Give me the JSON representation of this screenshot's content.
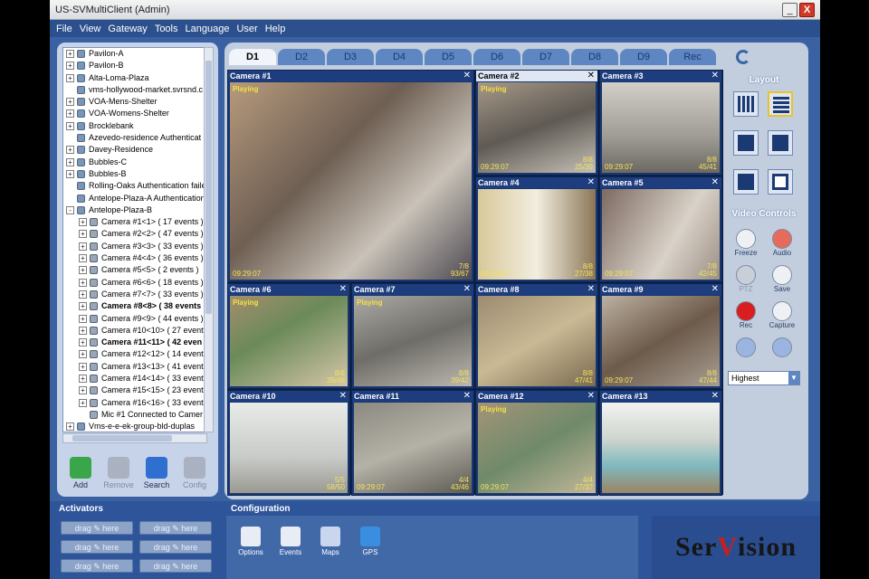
{
  "window": {
    "title": "US-SVMultiClient (Admin)",
    "minimize_glyph": "_",
    "close_glyph": "X"
  },
  "menu": [
    "File",
    "View",
    "Gateway",
    "Tools",
    "Language",
    "User",
    "Help"
  ],
  "tree": [
    {
      "label": "Pavilon-A",
      "lvl": 0,
      "exp": "+",
      "icon": "site"
    },
    {
      "label": "Pavilon-B",
      "lvl": 0,
      "exp": "+",
      "icon": "site"
    },
    {
      "label": "Alta-Loma-Plaza",
      "lvl": 0,
      "exp": "+",
      "icon": "site"
    },
    {
      "label": "vms-hollywood-market.svrsnd.c",
      "lvl": 0,
      "exp": "",
      "icon": "site"
    },
    {
      "label": "VOA-Mens-Shelter",
      "lvl": 0,
      "exp": "+",
      "icon": "site"
    },
    {
      "label": "VOA-Womens-Shelter",
      "lvl": 0,
      "exp": "+",
      "icon": "site"
    },
    {
      "label": "Brocklebank",
      "lvl": 0,
      "exp": "+",
      "icon": "site"
    },
    {
      "label": "Azevedo-residence Authenticat",
      "lvl": 0,
      "exp": "",
      "icon": "site"
    },
    {
      "label": "Davey-Residence",
      "lvl": 0,
      "exp": "+",
      "icon": "site"
    },
    {
      "label": "Bubbles-C",
      "lvl": 0,
      "exp": "+",
      "icon": "site"
    },
    {
      "label": "Bubbles-B",
      "lvl": 0,
      "exp": "+",
      "icon": "site"
    },
    {
      "label": "Rolling-Oaks Authentication faile",
      "lvl": 0,
      "exp": "",
      "icon": "site"
    },
    {
      "label": "Antelope-Plaza-A Authentication",
      "lvl": 0,
      "exp": "",
      "icon": "site"
    },
    {
      "label": "Antelope-Plaza-B",
      "lvl": 0,
      "exp": "-",
      "icon": "site"
    },
    {
      "label": "Camera #1<1> ( 17 events )",
      "lvl": 1,
      "exp": "+",
      "icon": "cam"
    },
    {
      "label": "Camera #2<2> ( 47 events )",
      "lvl": 1,
      "exp": "+",
      "icon": "cam"
    },
    {
      "label": "Camera #3<3> ( 33 events )",
      "lvl": 1,
      "exp": "+",
      "icon": "cam"
    },
    {
      "label": "Camera #4<4> ( 36 events )",
      "lvl": 1,
      "exp": "+",
      "icon": "cam"
    },
    {
      "label": "Camera #5<5> ( 2 events )",
      "lvl": 1,
      "exp": "+",
      "icon": "cam"
    },
    {
      "label": "Camera #6<6> ( 18 events )",
      "lvl": 1,
      "exp": "+",
      "icon": "cam"
    },
    {
      "label": "Camera #7<7> ( 33 events )",
      "lvl": 1,
      "exp": "+",
      "icon": "cam"
    },
    {
      "label": "Camera #8<8> ( 38 events",
      "lvl": 1,
      "exp": "+",
      "icon": "cam",
      "bold": true
    },
    {
      "label": "Camera #9<9> ( 44 events )",
      "lvl": 1,
      "exp": "+",
      "icon": "cam"
    },
    {
      "label": "Camera #10<10> ( 27 event",
      "lvl": 1,
      "exp": "+",
      "icon": "cam"
    },
    {
      "label": "Camera #11<11> ( 42 even",
      "lvl": 1,
      "exp": "+",
      "icon": "cam",
      "bold": true
    },
    {
      "label": "Camera #12<12> ( 14 event",
      "lvl": 1,
      "exp": "+",
      "icon": "cam"
    },
    {
      "label": "Camera #13<13> ( 41 event",
      "lvl": 1,
      "exp": "+",
      "icon": "cam"
    },
    {
      "label": "Camera #14<14> ( 33 event",
      "lvl": 1,
      "exp": "+",
      "icon": "cam"
    },
    {
      "label": "Camera #15<15> ( 23 event",
      "lvl": 1,
      "exp": "+",
      "icon": "cam"
    },
    {
      "label": "Camera #16<16> ( 33 event",
      "lvl": 1,
      "exp": "+",
      "icon": "cam"
    },
    {
      "label": "Mic #1 Connected to Camer",
      "lvl": 1,
      "exp": "",
      "icon": "mic"
    },
    {
      "label": "Vms-e-e-ek-group-bld-duplas",
      "lvl": 0,
      "exp": "+",
      "icon": "site"
    }
  ],
  "tree_tools": [
    {
      "label": "Add",
      "disabled": false,
      "icon": "add-icon"
    },
    {
      "label": "Remove",
      "disabled": true,
      "icon": "remove-icon"
    },
    {
      "label": "Search",
      "disabled": false,
      "icon": "search-icon"
    },
    {
      "label": "Config",
      "disabled": true,
      "icon": "config-icon"
    }
  ],
  "tabs": [
    "D1",
    "D2",
    "D3",
    "D4",
    "D5",
    "D6",
    "D7",
    "D8",
    "D9",
    "Rec"
  ],
  "active_tab": 0,
  "cameras": [
    {
      "title": "Camera #1",
      "playing": "Playing",
      "time": "09:29:07",
      "frames": "7/8",
      "frames2": "93/67",
      "bg": "linear-gradient(135deg,#b69a7c,#6f5f53 40%,#c9c2b8 70%,#4e4a52)"
    },
    {
      "title": "Camera #2",
      "playing": "Playing",
      "time": "09:29:07",
      "frames": "8/8",
      "frames2": "25/39",
      "bg": "linear-gradient(160deg,#a59887,#5f5a54 50%,#c5c0b6)"
    },
    {
      "title": "Camera #3",
      "playing": "",
      "time": "09:29:07",
      "frames": "8/8",
      "frames2": "45/41",
      "bg": "linear-gradient(180deg,#d2cfc8,#9f9b95 60%,#6c6963)"
    },
    {
      "title": "Camera #4",
      "playing": "",
      "time": "09:29:07",
      "frames": "8/8",
      "frames2": "27/38",
      "bg": "linear-gradient(90deg,#d8c89a,#f2eedf 50%,#8a7657)"
    },
    {
      "title": "Camera #5",
      "playing": "",
      "time": "09:29:07",
      "frames": "7/8",
      "frames2": "42/45",
      "bg": "linear-gradient(120deg,#7d6a61,#d9d2c8 60%,#9c8f86)"
    },
    {
      "title": "Camera #6",
      "playing": "Playing",
      "time": "",
      "frames": "8/8",
      "frames2": "39/46",
      "bg": "linear-gradient(150deg,#a38e6c,#6b8a5a 40%,#d4c6a7)"
    },
    {
      "title": "Camera #7",
      "playing": "Playing",
      "time": "",
      "frames": "8/8",
      "frames2": "39/42",
      "bg": "linear-gradient(160deg,#aaa9a3,#6f6d68 50%,#bcb8b0)"
    },
    {
      "title": "Camera #8",
      "playing": "",
      "time": "",
      "frames": "8/8",
      "frames2": "47/41",
      "bg": "linear-gradient(150deg,#9c8b71,#c9b994 50%,#7a6a50)"
    },
    {
      "title": "Camera #9",
      "playing": "",
      "time": "09:29:07",
      "frames": "8/8",
      "frames2": "47/44",
      "bg": "linear-gradient(150deg,#bdb1a1,#6d5a4a 50%,#a79f93)"
    },
    {
      "title": "Camera #10",
      "playing": "",
      "time": "",
      "frames": "5/5",
      "frames2": "58/50",
      "bg": "linear-gradient(180deg,#e9ebe9,#c9cbc8 60%,#9a9a92)"
    },
    {
      "title": "Camera #11",
      "playing": "",
      "time": "09:29:07",
      "frames": "4/4",
      "frames2": "43/46",
      "bg": "linear-gradient(160deg,#8c8a80,#b4b1a7 50%,#5d5a52)"
    },
    {
      "title": "Camera #12",
      "playing": "Playing",
      "time": "09:29:07",
      "frames": "4/4",
      "frames2": "27/37",
      "bg": "linear-gradient(150deg,#a49479,#6f8a6a 50%,#c3b79a)"
    },
    {
      "title": "Camera #13",
      "playing": "",
      "time": "",
      "frames": "",
      "frames2": "",
      "bg": "linear-gradient(180deg,#f1f3f0,#cfd5cf 40%,#7fb9be 70%,#9b8464)"
    }
  ],
  "selected_camera": 1,
  "layout_title": "Layout",
  "video_controls_title": "Video Controls",
  "video_controls": [
    {
      "label": "Freeze",
      "icon": "freeze-icon",
      "disabled": false
    },
    {
      "label": "Audio",
      "icon": "audio-icon",
      "disabled": false
    },
    {
      "label": "PTZ",
      "icon": "ptz-icon",
      "disabled": true
    },
    {
      "label": "Save",
      "icon": "save-icon",
      "disabled": false
    },
    {
      "label": "Rec",
      "icon": "record-icon",
      "disabled": false
    },
    {
      "label": "Capture",
      "icon": "capture-icon",
      "disabled": false
    },
    {
      "label": "",
      "icon": "zoom-in-icon",
      "disabled": false
    },
    {
      "label": "",
      "icon": "zoom-out-icon",
      "disabled": false
    }
  ],
  "quality": "Highest",
  "activators_title": "Activators",
  "drag_label": "drag  ✎  here",
  "configuration_title": "Configuration",
  "config_buttons": [
    {
      "label": "Options",
      "icon": "options-icon"
    },
    {
      "label": "Events",
      "icon": "events-icon"
    },
    {
      "label": "Maps",
      "icon": "maps-icon"
    },
    {
      "label": "GPS",
      "icon": "gps-icon"
    }
  ],
  "logo": {
    "part1": "Ser",
    "part2": "V",
    "part3": "ision"
  },
  "colors": {
    "frame": "#3a62a3",
    "accent_yellow": "#e8c22d",
    "logo_red": "#c81e1e"
  }
}
